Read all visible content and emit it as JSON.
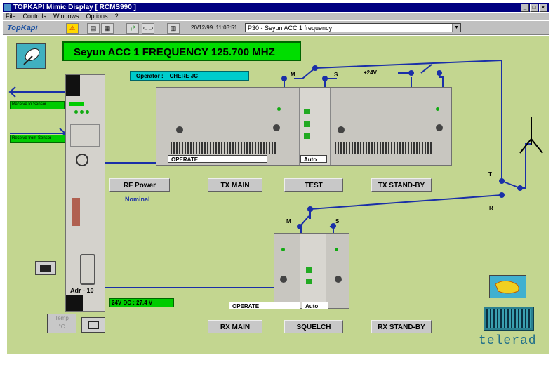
{
  "window": {
    "title": "TOPKAPI   Mimic Display [ RCMS990 ]",
    "controls": [
      "_",
      "□",
      "×"
    ]
  },
  "menu": [
    "File",
    "Controls",
    "Windows",
    "Options",
    "?"
  ],
  "toolbar": {
    "logo": "TopKapi",
    "date": "20/12/99",
    "time": "11:03:51",
    "view_selector": "P30 - Seyun ACC 1 frequency"
  },
  "header": {
    "frequency_title": "Seyun    ACC 1 FREQUENCY    125.700 MHZ",
    "operator_label": "Operator :",
    "operator_name": "CHERE JC"
  },
  "left_panel": {
    "receive_label": "Receive to Sensor",
    "receive_from_label": "Receive from Sensor",
    "addr_label": "Adr -  10",
    "temp_label": "Temp",
    "temp_unit": "°C",
    "power_status": "24V DC :  27.4 V"
  },
  "tx": {
    "switch_main": "M",
    "switch_standby": "S",
    "supply": "+24V",
    "main_status": "OPERATE",
    "test_status": "Auto",
    "buttons": {
      "rf_power": "RF Power",
      "tx_main": "TX MAIN",
      "test": "TEST",
      "tx_standby": "TX STAND-BY"
    },
    "rf_power_status": "Nominal",
    "t_label": "T",
    "r_label": "R"
  },
  "rx": {
    "switch_main": "M",
    "switch_standby": "S",
    "main_status": "OPERATE",
    "squelch_status": "Auto",
    "buttons": {
      "rx_main": "RX MAIN",
      "squelch": "SQUELCH",
      "rx_standby": "RX STAND-BY"
    }
  },
  "brand": "telerad",
  "colors": {
    "background": "#c3d690",
    "frequency_banner": "#00dd00",
    "operator_banner": "#00cccc",
    "line": "#1a2fa8"
  }
}
